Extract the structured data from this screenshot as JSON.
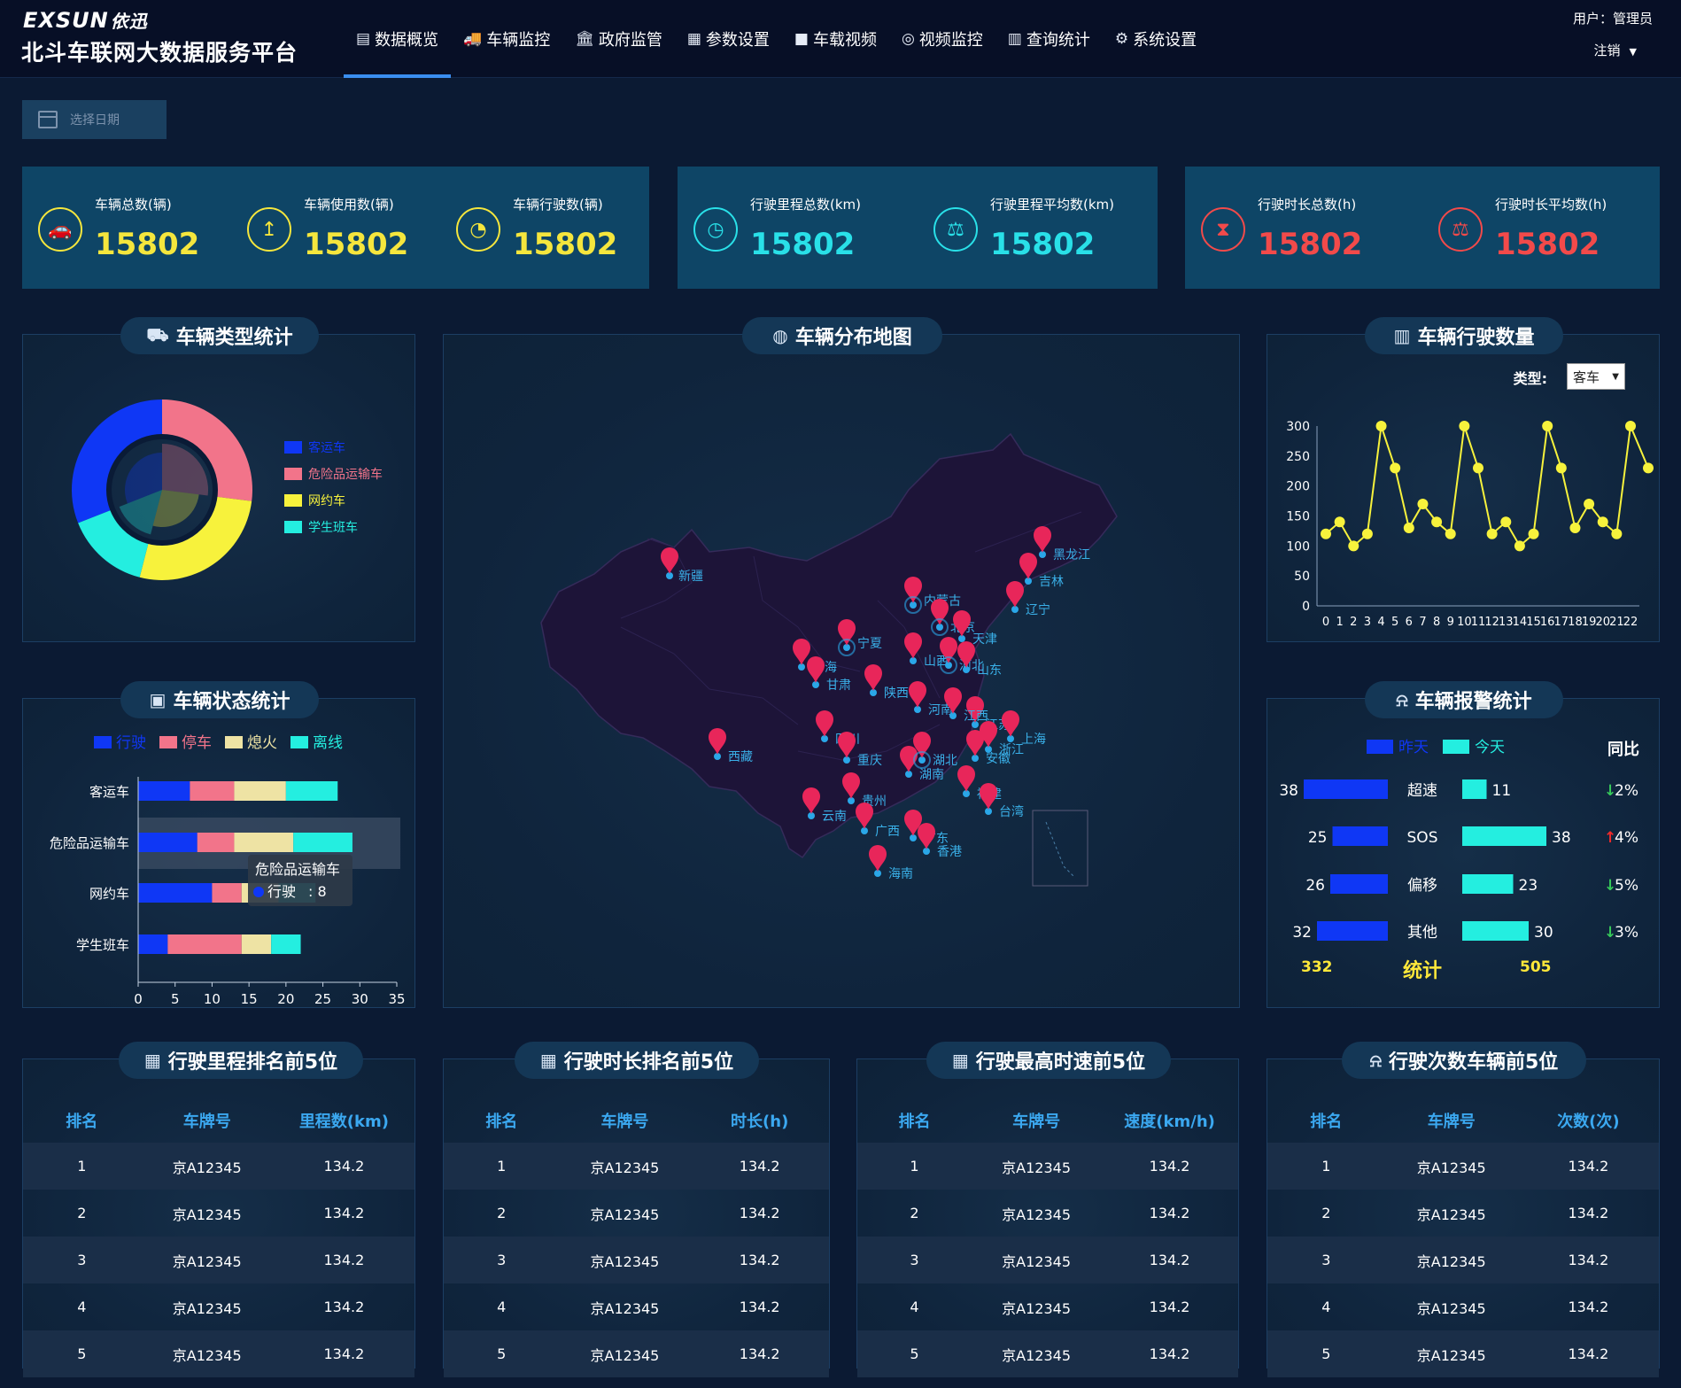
{
  "header": {
    "logo": "EXSUN",
    "logo_cn": "依迅",
    "title": "北斗车联网大数据服务平台",
    "nav": [
      {
        "label": "数据概览",
        "icon": "dashboard-icon",
        "glyph": "▤",
        "active": true
      },
      {
        "label": "车辆监控",
        "icon": "truck-icon",
        "glyph": "🚚",
        "active": false
      },
      {
        "label": "政府监管",
        "icon": "government-icon",
        "glyph": "🏛",
        "active": false
      },
      {
        "label": "参数设置",
        "icon": "settings-panel-icon",
        "glyph": "▦",
        "active": false
      },
      {
        "label": "车载视频",
        "icon": "video-camera-icon",
        "glyph": "■",
        "active": false
      },
      {
        "label": "视频监控",
        "icon": "webcam-icon",
        "glyph": "◎",
        "active": false
      },
      {
        "label": "查询统计",
        "icon": "bar-chart-icon",
        "glyph": "▥",
        "active": false
      },
      {
        "label": "系统设置",
        "icon": "gear-icon",
        "glyph": "⚙",
        "active": false
      }
    ],
    "user": "用户：管理员",
    "logout": "注销"
  },
  "date_picker": {
    "placeholder": "选择日期"
  },
  "stats": [
    {
      "label": "车辆总数(辆)",
      "value": "15802",
      "icon": "car-icon",
      "glyph": "🚗",
      "color": "yellow"
    },
    {
      "label": "车辆使用数(辆)",
      "value": "15802",
      "icon": "upload-icon",
      "glyph": "↥",
      "color": "yellow"
    },
    {
      "label": "车辆行驶数(辆)",
      "value": "15802",
      "icon": "pie-clock-icon",
      "glyph": "◔",
      "color": "yellow"
    },
    {
      "label": "行驶里程总数(km)",
      "value": "15802",
      "icon": "speedometer-icon",
      "glyph": "◷",
      "color": "cyan"
    },
    {
      "label": "行驶里程平均数(km)",
      "value": "15802",
      "icon": "scale-icon",
      "glyph": "⚖",
      "color": "cyan"
    },
    {
      "label": "行驶时长总数(h)",
      "value": "15802",
      "icon": "hourglass-icon",
      "glyph": "⧗",
      "color": "red"
    },
    {
      "label": "行驶时长平均数(h)",
      "value": "15802",
      "icon": "scale-icon",
      "glyph": "⚖",
      "color": "red"
    }
  ],
  "panels": {
    "vehicle_type": "车辆类型统计",
    "map": "车辆分布地图",
    "driving_count": "车辆行驶数量",
    "vehicle_status": "车辆状态统计",
    "alarm": "车辆报警统计",
    "mileage_rank": "行驶里程排名前5位",
    "duration_rank": "行驶时长排名前5位",
    "speed_rank": "行驶最高时速前5位",
    "trips_rank": "行驶次数车辆前5位"
  },
  "colors": {
    "blue": "#0f37f5",
    "pink": "#f2748a",
    "yellow": "#f7f23c",
    "cyan": "#24eee0",
    "khaki": "#eee3a4",
    "gold": "#ffe83a",
    "red_pin": "#e8265a",
    "bg": "#0b1a33"
  },
  "chart_data": [
    {
      "type": "pie",
      "name": "vehicle_type",
      "categories": [
        "客运车",
        "危险品运输车",
        "网约车",
        "学生班车"
      ],
      "values": [
        31,
        27,
        27,
        15
      ],
      "legend_position": "right"
    },
    {
      "type": "bar",
      "name": "vehicle_status",
      "orientation": "horizontal",
      "stacked": true,
      "categories": [
        "客运车",
        "危险品运输车",
        "网约车",
        "学生班车"
      ],
      "series": [
        {
          "name": "行驶",
          "values": [
            7,
            8,
            10,
            4
          ]
        },
        {
          "name": "停车",
          "values": [
            6,
            5,
            4,
            10
          ]
        },
        {
          "name": "熄火",
          "values": [
            7,
            8,
            5,
            4
          ]
        },
        {
          "name": "离线",
          "values": [
            7,
            8,
            5,
            4
          ]
        }
      ],
      "xlim": [
        0,
        35
      ],
      "xticks": [
        0,
        5,
        10,
        15,
        20,
        25,
        30,
        35
      ],
      "tooltip": {
        "title": "危险品运输车",
        "series": "行驶",
        "value": 8
      }
    },
    {
      "type": "line",
      "name": "driving_count",
      "x": [
        0,
        1,
        2,
        3,
        4,
        5,
        6,
        7,
        8,
        9,
        10,
        11,
        12,
        13,
        14,
        15,
        16,
        17,
        18,
        19,
        20,
        21,
        22
      ],
      "values": [
        120,
        140,
        100,
        120,
        300,
        230,
        130,
        170,
        140,
        120,
        300,
        230,
        120,
        140,
        100,
        120,
        300,
        230,
        130,
        170,
        140,
        120,
        300
      ],
      "last_value": 230,
      "ylim": [
        0,
        300
      ],
      "yticks": [
        0,
        50,
        100,
        150,
        200,
        250,
        300
      ],
      "type_label": "类型:",
      "type_value": "客车"
    },
    {
      "type": "bar",
      "name": "alarm",
      "categories": [
        "超速",
        "SOS",
        "偏移",
        "其他"
      ],
      "series": [
        {
          "name": "昨天",
          "values": [
            38,
            25,
            26,
            32
          ]
        },
        {
          "name": "今天",
          "values": [
            11,
            38,
            23,
            30
          ]
        }
      ],
      "yoy_label": "同比",
      "yoy": [
        {
          "dir": "down",
          "value": "2%"
        },
        {
          "dir": "up",
          "value": "4%"
        },
        {
          "dir": "down",
          "value": "5%"
        },
        {
          "dir": "down",
          "value": "3%"
        }
      ],
      "total_label": "统计",
      "total_yesterday": "332",
      "total_today": "505"
    }
  ],
  "map": {
    "labels": [
      "新疆",
      "西藏",
      "青海",
      "甘肃",
      "宁夏",
      "内蒙古",
      "陕西",
      "四川",
      "重庆",
      "云南",
      "贵州",
      "广西",
      "海南",
      "湖南",
      "湖北",
      "河南",
      "山西",
      "北京",
      "天津",
      "河北",
      "山东",
      "江苏",
      "上海",
      "浙江",
      "安徽",
      "江西",
      "福建",
      "台湾",
      "广东",
      "香港",
      "辽宁",
      "吉林",
      "黑龙江"
    ]
  },
  "tables": {
    "mileage": {
      "headers": [
        "排名",
        "车牌号",
        "里程数(km)"
      ],
      "rows": [
        [
          "1",
          "京A12345",
          "134.2"
        ],
        [
          "2",
          "京A12345",
          "134.2"
        ],
        [
          "3",
          "京A12345",
          "134.2"
        ],
        [
          "4",
          "京A12345",
          "134.2"
        ],
        [
          "5",
          "京A12345",
          "134.2"
        ]
      ]
    },
    "duration": {
      "headers": [
        "排名",
        "车牌号",
        "时长(h)"
      ],
      "rows": [
        [
          "1",
          "京A12345",
          "134.2"
        ],
        [
          "2",
          "京A12345",
          "134.2"
        ],
        [
          "3",
          "京A12345",
          "134.2"
        ],
        [
          "4",
          "京A12345",
          "134.2"
        ],
        [
          "5",
          "京A12345",
          "134.2"
        ]
      ]
    },
    "speed": {
      "headers": [
        "排名",
        "车牌号",
        "速度(km/h)"
      ],
      "rows": [
        [
          "1",
          "京A12345",
          "134.2"
        ],
        [
          "2",
          "京A12345",
          "134.2"
        ],
        [
          "3",
          "京A12345",
          "134.2"
        ],
        [
          "4",
          "京A12345",
          "134.2"
        ],
        [
          "5",
          "京A12345",
          "134.2"
        ]
      ]
    },
    "trips": {
      "headers": [
        "排名",
        "车牌号",
        "次数(次)"
      ],
      "rows": [
        [
          "1",
          "京A12345",
          "134.2"
        ],
        [
          "2",
          "京A12345",
          "134.2"
        ],
        [
          "3",
          "京A12345",
          "134.2"
        ],
        [
          "4",
          "京A12345",
          "134.2"
        ],
        [
          "5",
          "京A12345",
          "134.2"
        ]
      ]
    }
  }
}
